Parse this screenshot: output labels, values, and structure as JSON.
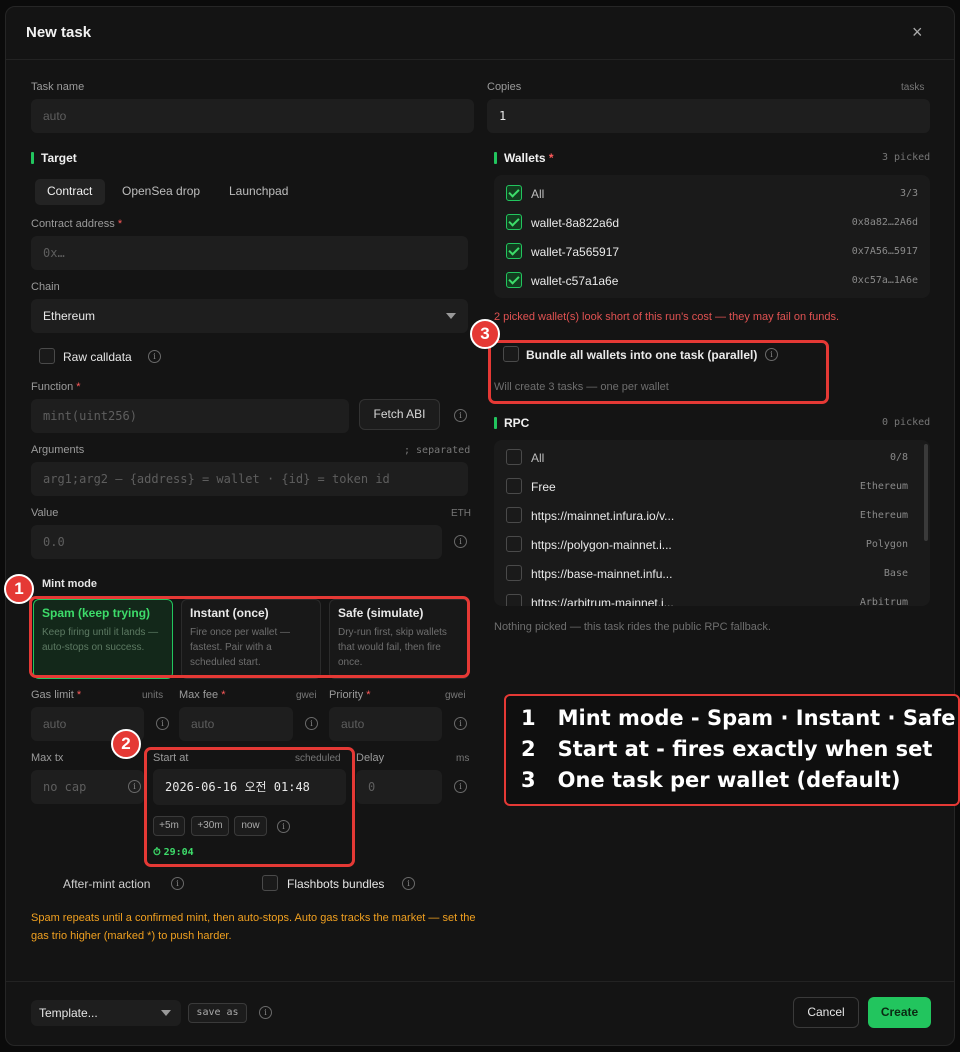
{
  "modal": {
    "title": "New task"
  },
  "task_name": {
    "label": "Task name",
    "placeholder": "auto"
  },
  "copies": {
    "label": "Copies",
    "unit": "tasks",
    "value": "1"
  },
  "target": {
    "title": "Target",
    "tabs": [
      "Contract",
      "OpenSea drop",
      "Launchpad"
    ],
    "contract_label": "Contract address",
    "contract_placeholder": "0x…",
    "chain_label": "Chain",
    "chain_value": "Ethereum",
    "raw_calldata": "Raw calldata",
    "function_label": "Function",
    "function_placeholder": "mint(uint256)",
    "fetch_abi": "Fetch ABI",
    "arguments_label": "Arguments",
    "arguments_hint": "; separated",
    "arguments_placeholder": "arg1;arg2 — {address} = wallet · {id} = token id",
    "value_label": "Value",
    "value_unit": "ETH",
    "value_placeholder": "0.0"
  },
  "mint_mode": {
    "label": "Mint mode",
    "cards": [
      {
        "title": "Spam (keep trying)",
        "desc": "Keep firing until it lands — auto-stops on success."
      },
      {
        "title": "Instant (once)",
        "desc": "Fire once per wallet — fastest. Pair with a scheduled start."
      },
      {
        "title": "Safe (simulate)",
        "desc": "Dry-run first, skip wallets that would fail, then fire once."
      }
    ]
  },
  "gas": {
    "gas_limit": "Gas limit",
    "gas_limit_unit": "units",
    "gas_limit_placeholder": "auto",
    "max_fee": "Max fee",
    "max_fee_unit": "gwei",
    "max_fee_placeholder": "auto",
    "priority": "Priority",
    "priority_unit": "gwei",
    "priority_placeholder": "auto",
    "max_tx": "Max tx",
    "max_tx_placeholder": "no cap",
    "start_at": "Start at",
    "start_at_hint": "scheduled",
    "start_at_value": "2026-06-16 오전 01:48",
    "chips": [
      "+5m",
      "+30m",
      "now"
    ],
    "countdown": "29:04",
    "delay": "Delay",
    "delay_unit": "ms",
    "delay_placeholder": "0"
  },
  "after_mint": "After-mint action",
  "flashbots": "Flashbots bundles",
  "warning": "Spam repeats until a confirmed mint, then auto-stops. Auto gas tracks the market — set the gas trio higher (marked *) to push harder.",
  "wallets": {
    "title": "Wallets",
    "picked": "3 picked",
    "all_label": "All",
    "all_count": "3/3",
    "items": [
      {
        "name": "wallet-8a822a6d",
        "addr": "0x8a82…2A6d"
      },
      {
        "name": "wallet-7a565917",
        "addr": "0x7A56…5917"
      },
      {
        "name": "wallet-c57a1a6e",
        "addr": "0xc57a…1A6e"
      }
    ],
    "warning": "2 picked wallet(s) look short of this run's cost — they may fail on funds.",
    "bundle_label": "Bundle all wallets into one task (parallel)",
    "bundle_hint": "Will create 3 tasks — one per wallet"
  },
  "rpc": {
    "title": "RPC",
    "picked": "0 picked",
    "all_label": "All",
    "all_count": "0/8",
    "items": [
      {
        "name": "Free",
        "chain": "Ethereum"
      },
      {
        "name": "https://mainnet.infura.io/v...",
        "chain": "Ethereum"
      },
      {
        "name": "https://polygon-mainnet.i...",
        "chain": "Polygon"
      },
      {
        "name": "https://base-mainnet.infu...",
        "chain": "Base"
      },
      {
        "name": "https://arbitrum-mainnet.i...",
        "chain": "Arbitrum"
      }
    ],
    "hint": "Nothing picked — this task rides the public RPC fallback."
  },
  "footer": {
    "template": "Template...",
    "save_as": "save as",
    "cancel": "Cancel",
    "create": "Create"
  },
  "annotations": {
    "badges": [
      "1",
      "2",
      "3"
    ],
    "legend": [
      {
        "num": "1",
        "text": "Mint mode - Spam · Instant · Safe"
      },
      {
        "num": "2",
        "text": "Start at - fires exactly when set"
      },
      {
        "num": "3",
        "text": "One task per wallet (default)"
      }
    ]
  },
  "colors": {
    "accent": "#22c55e",
    "annotation": "#e53935",
    "warning": "#f0a020",
    "danger": "#e05252"
  },
  "icons": [
    "close-icon",
    "chevron-down-icon",
    "info-icon",
    "check-icon",
    "timer-icon"
  ]
}
